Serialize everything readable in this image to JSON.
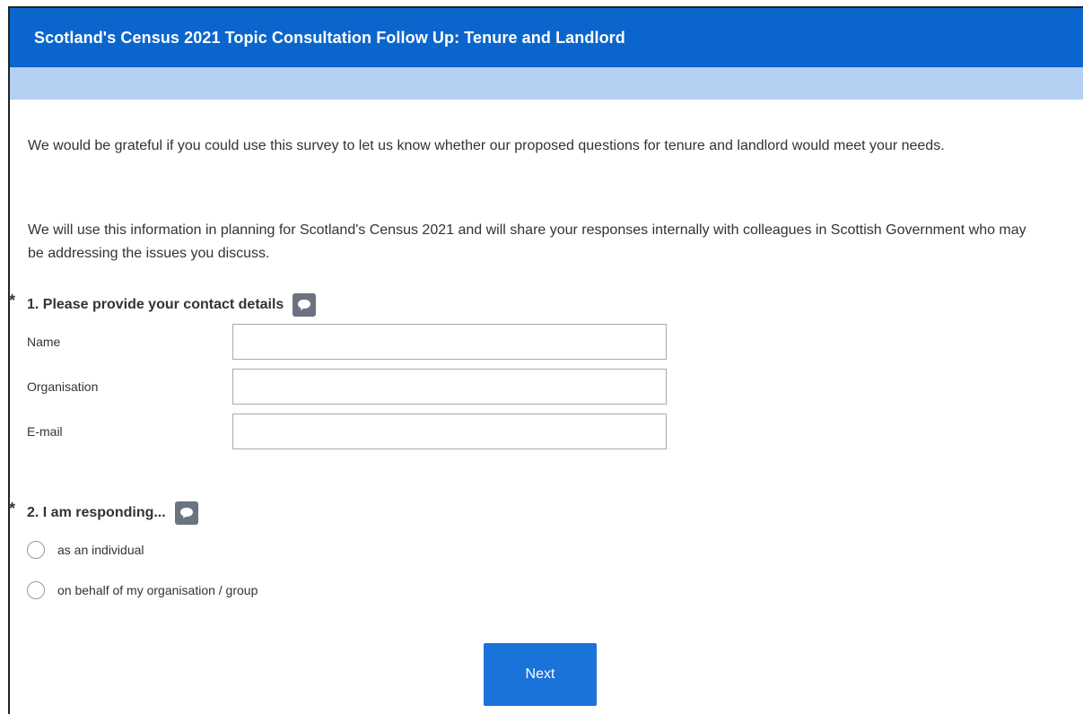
{
  "header": {
    "title": "Scotland's Census 2021 Topic Consultation Follow Up: Tenure and Landlord"
  },
  "intro": {
    "paragraph_1": "We would be grateful if you could use this survey to let us know whether our proposed questions for tenure and landlord would meet your needs.",
    "paragraph_2": "We will use this information in planning for Scotland's Census 2021 and will share your responses internally with colleagues in Scottish Government who may be addressing the issues you discuss."
  },
  "question_1": {
    "required_marker": "*",
    "title": "1. Please provide your contact details",
    "icon": "comment-icon",
    "fields": [
      {
        "label": "Name",
        "value": "",
        "placeholder": ""
      },
      {
        "label": "Organisation",
        "value": "",
        "placeholder": ""
      },
      {
        "label": "E-mail",
        "value": "",
        "placeholder": ""
      }
    ]
  },
  "question_2": {
    "required_marker": "*",
    "title": "2. I am responding...",
    "icon": "comment-icon",
    "options": [
      {
        "label": "as an individual",
        "selected": false
      },
      {
        "label": "on behalf of my organisation / group",
        "selected": false
      }
    ]
  },
  "footer": {
    "next_label": "Next"
  },
  "colors": {
    "header_bg": "#0a66cc",
    "subheader_bg": "#b3d0f2",
    "button_bg": "#1a73d9",
    "icon_bg": "#6b7280"
  }
}
